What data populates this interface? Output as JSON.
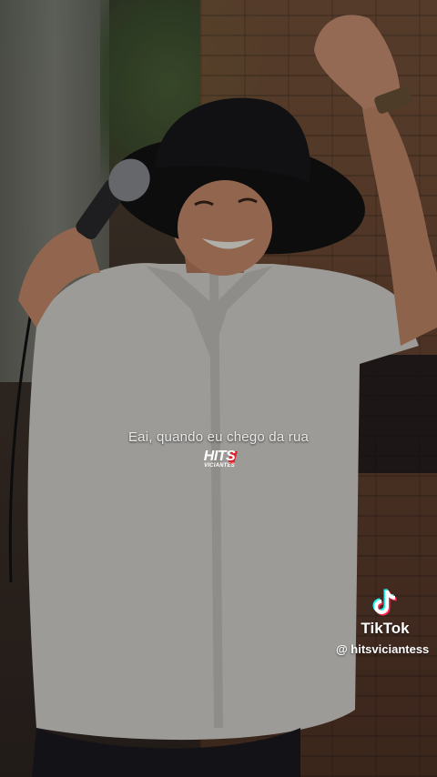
{
  "video": {
    "caption": "Eai, quando eu chego da rua"
  },
  "brand_logo": {
    "word": "HITS",
    "sub": "VICIANTES",
    "accent_color": "#d8262e"
  },
  "watermark": {
    "platform": "TikTok",
    "handle": "@ hitsviciantess",
    "icon": "tiktok-note-icon"
  },
  "colors": {
    "caption_text": "#e9e9e9",
    "watermark_text": "#ffffff",
    "tiktok_cyan": "#25f4ee",
    "tiktok_red": "#fe2c55"
  }
}
